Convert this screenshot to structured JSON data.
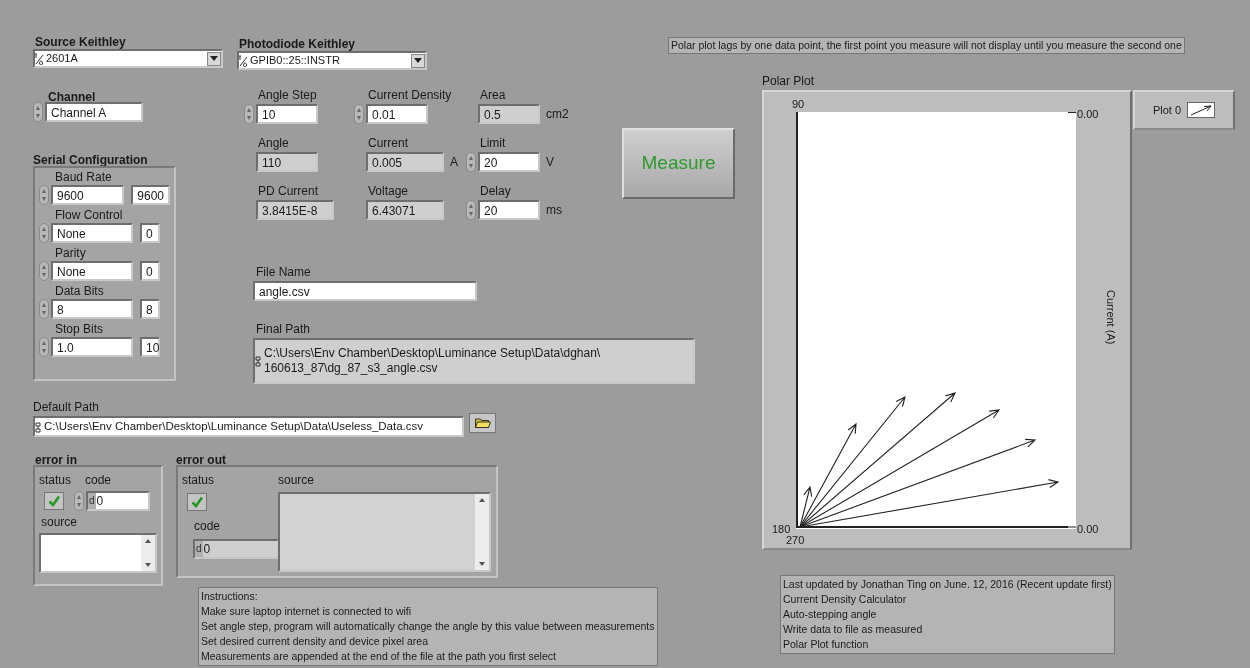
{
  "source_keithley": {
    "label": "Source Keithley",
    "value": "2601A"
  },
  "photodiode_keithley": {
    "label": "Photodiode Keithley",
    "value": "GPIB0::25::INSTR"
  },
  "channel": {
    "label": "Channel",
    "value": "Channel A"
  },
  "serial_configuration": {
    "title": "Serial Configuration",
    "fields": [
      {
        "label": "Baud Rate",
        "value": "9600",
        "code": "9600"
      },
      {
        "label": "Flow Control",
        "value": "None",
        "code": "0"
      },
      {
        "label": "Parity",
        "value": "None",
        "code": "0"
      },
      {
        "label": "Data Bits",
        "value": "8",
        "code": "8"
      },
      {
        "label": "Stop Bits",
        "value": "1.0",
        "code": "10"
      }
    ]
  },
  "numerics": [
    {
      "label": "Angle Step",
      "value": "10",
      "kind": "control"
    },
    {
      "label": "Current Density",
      "value": "0.01",
      "kind": "control"
    },
    {
      "label": "Area",
      "value": "0.5",
      "kind": "indicator",
      "unit": "cm2"
    },
    {
      "label": "Angle",
      "value": "110",
      "kind": "indicator"
    },
    {
      "label": "Current",
      "value": "0.005",
      "kind": "indicator",
      "unit": "A"
    },
    {
      "label": "Limit",
      "value": "20",
      "kind": "control",
      "unit": "V"
    },
    {
      "label": "PD Current",
      "value": "3.8415E-8",
      "kind": "indicator"
    },
    {
      "label": "Voltage",
      "value": "6.43071",
      "kind": "indicator"
    },
    {
      "label": "Delay",
      "value": "20",
      "kind": "control",
      "unit": "ms"
    }
  ],
  "file_name": {
    "label": "File Name",
    "value": "angle.csv"
  },
  "final_path": {
    "label": "Final Path",
    "lines": [
      "C:\\Users\\Env Chamber\\Desktop\\Luminance Setup\\Data\\dghan\\",
      "160613_87\\dg_87_s3_angle.csv"
    ]
  },
  "default_path": {
    "label": "Default Path",
    "value": "C:\\Users\\Env Chamber\\Desktop\\Luminance Setup\\Data\\Useless_Data.csv"
  },
  "error_in": {
    "title": "error in",
    "status_label": "status",
    "no_error": true,
    "code_label": "code",
    "radix": "d",
    "code": "0",
    "source_label": "source"
  },
  "error_out": {
    "title": "error out",
    "status_label": "status",
    "no_error": true,
    "code_label": "code",
    "radix": "d",
    "code": "0",
    "source_label": "source"
  },
  "instructions": [
    "Instructions:",
    "Make sure laptop internet is connected to wifi",
    "Set angle step, program will automatically change the angle by this value between measurements",
    "Set desired current density and device pixel area",
    "Measurements are appended at the end of the file at the path you first select"
  ],
  "measure_button": "Measure",
  "note": "Polar plot lags by one data point, the first point you measure will not display until you measure the second one",
  "polar_plot": {
    "title": "Polar Plot",
    "label_90": "90",
    "label_180": "180",
    "label_270": "270",
    "top_scale": "0.00",
    "bottom_scale": "0.00",
    "axis_label": "Current (A)",
    "legend": "Plot 0"
  },
  "updates": [
    "Last updated by Jonathan Ting on June. 12, 2016 (Recent update first)",
    "Current Density Calculator",
    "Auto-stepping angle",
    "Write data to file as measured",
    "Polar Plot function"
  ]
}
